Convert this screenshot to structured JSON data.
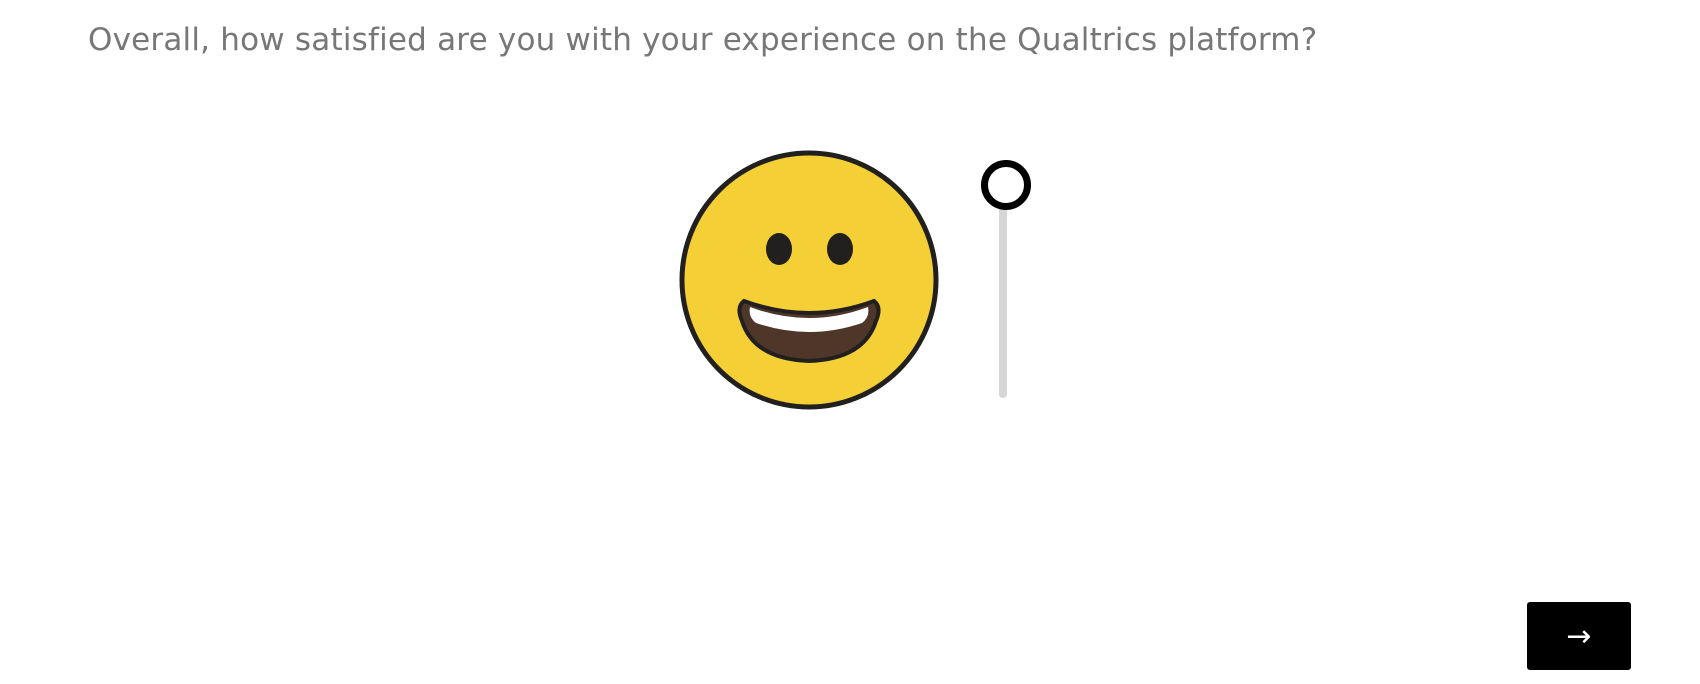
{
  "question": {
    "text": "Overall, how satisfied are you with your experience on the Qualtrics platform?"
  },
  "face": {
    "icon": "grinning-face-icon",
    "face_color": "#F4CF35",
    "outline_color": "#221F1F",
    "mouth_color": "#4E3628",
    "teeth_color": "#FFFFFF"
  },
  "slider": {
    "value_fraction": 1.0,
    "track_color": "#D6D6D6",
    "handle_color": "#000000"
  },
  "navigation": {
    "next_label": "→",
    "next_icon": "arrow-right-icon",
    "button_color": "#000000"
  }
}
